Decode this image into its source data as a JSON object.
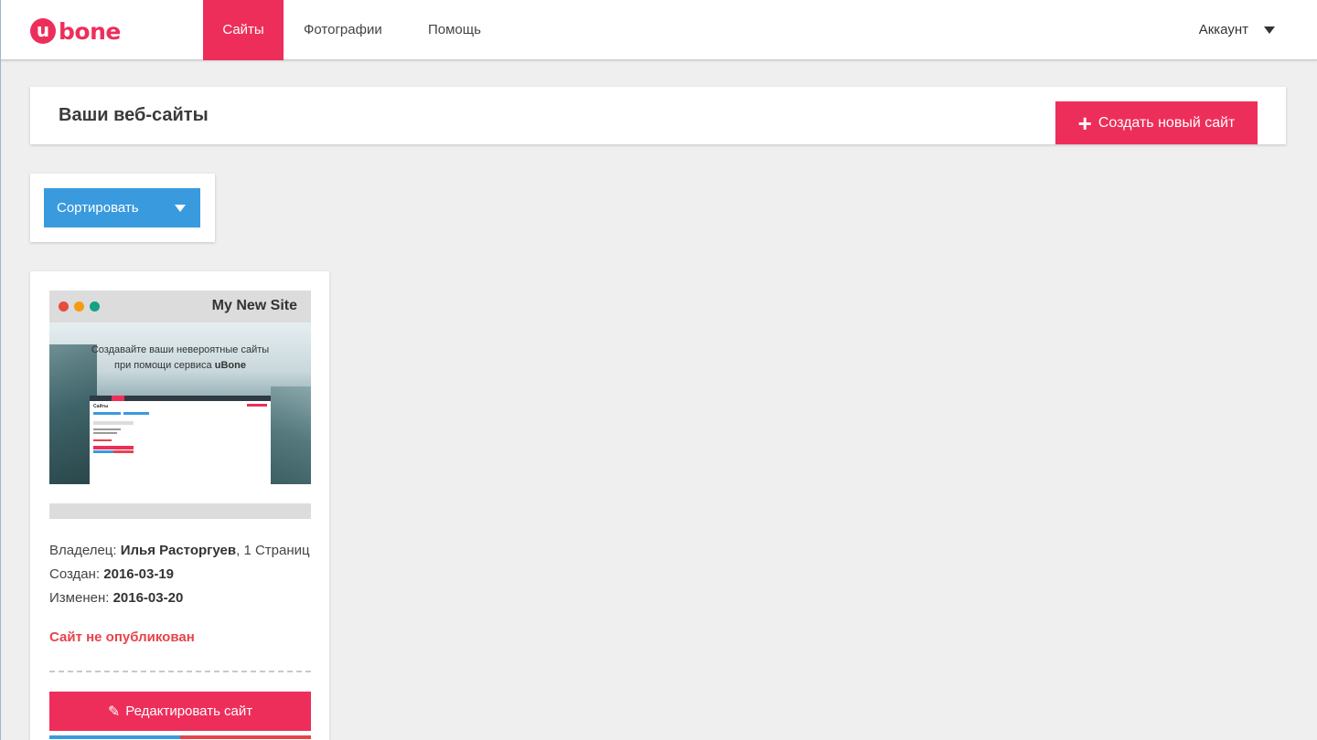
{
  "brand": {
    "logo_mark": "u",
    "logo_text": "bone",
    "color": "#ee2e5a"
  },
  "nav": {
    "items": [
      {
        "label": "Сайты",
        "active": true
      },
      {
        "label": "Фотографии",
        "active": false
      },
      {
        "label": "Помощь",
        "active": false
      }
    ],
    "account_label": "Аккаунт"
  },
  "header": {
    "title": "Ваши веб-сайты",
    "create_button": "Создать новый сайт",
    "create_icon": "plus-icon"
  },
  "sort": {
    "label": "Сортировать",
    "icon": "chevron-down-icon"
  },
  "site_card": {
    "site_name": "My New Site",
    "preview": {
      "line1": "Создавайте ваши невероятные сайты",
      "line2_prefix": "при помощи сервиса",
      "line2_brand": "uBone",
      "mini_title": "Сайты"
    },
    "owner_label": "Владелец:",
    "owner_name": "Илья Расторгуев",
    "pages_text": ", 1 Страниц",
    "created_label": "Создан:",
    "created_date": "2016-03-19",
    "modified_label": "Изменен:",
    "modified_date": "2016-03-20",
    "status": "Сайт не опубликован",
    "edit_button": "Редактировать сайт",
    "edit_icon": "edit-icon"
  },
  "colors": {
    "accent": "#ee2e5a",
    "sort_button": "#3a9ade",
    "status_unpublished": "#e8434a",
    "dot_red": "#e74c3c",
    "dot_orange": "#f39c12",
    "dot_green": "#16a085"
  }
}
